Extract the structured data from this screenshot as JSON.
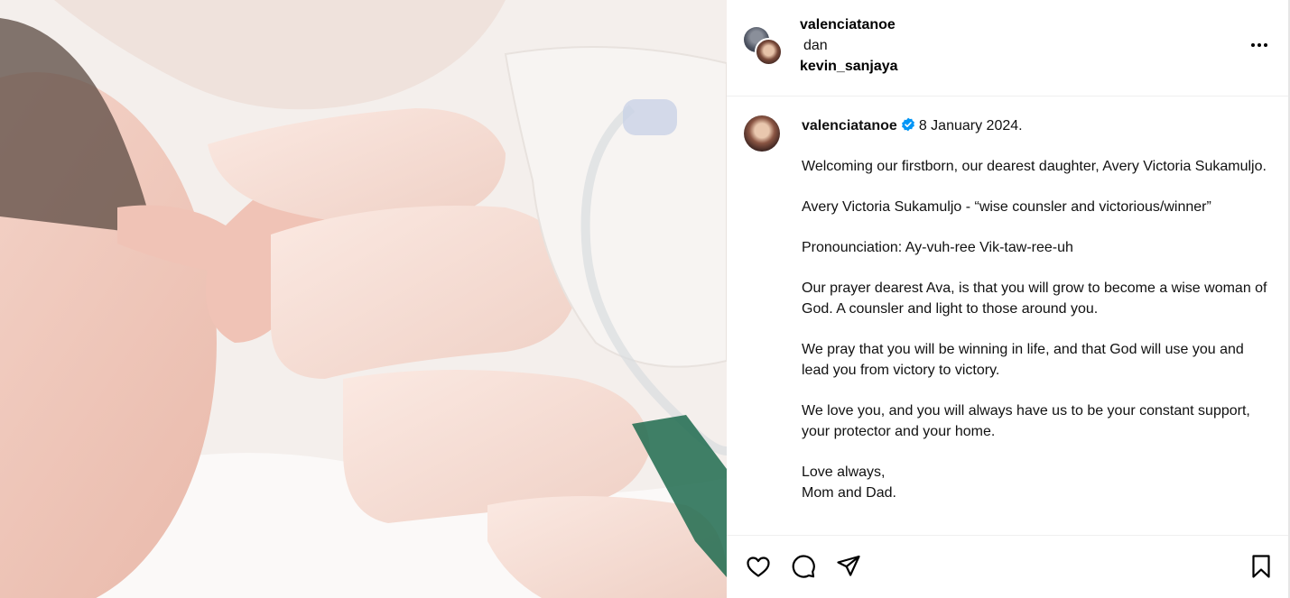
{
  "post": {
    "photo_alt": "newborn baby holding parent's finger",
    "header": {
      "user1": "valenciatanoe",
      "separator": "dan",
      "user2": "kevin_sanjaya",
      "more_icon": "more-horizontal-icon"
    },
    "caption": {
      "username": "valenciatanoe",
      "verified_icon": "verified-badge-icon",
      "date": "8 January 2024.",
      "paragraphs": [
        "Welcoming our firstborn, our dearest daughter, Avery Victoria Sukamuljo.",
        "Avery Victoria Sukamuljo - “wise counsler and victorious/winner”",
        "Pronounciation: Ay-vuh-ree Vik-taw-ree-uh",
        "Our prayer dearest Ava, is that you will grow to become a wise woman of God. A counsler and light to those around you.",
        "We pray that you will be winning in life, and that God will use you and lead you from victory to victory.",
        "We love you, and you will always have us to be your constant support, your protector and your home.",
        "Love always,",
        "Mom and Dad."
      ]
    },
    "actions": {
      "like_icon": "heart-icon",
      "comment_icon": "comment-icon",
      "share_icon": "send-icon",
      "save_icon": "bookmark-icon"
    }
  }
}
